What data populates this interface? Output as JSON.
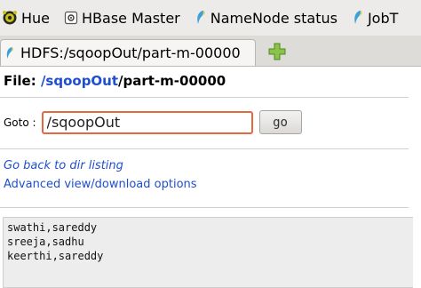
{
  "bookmarks": [
    {
      "label": "Hue",
      "icon": "hue-logo-icon"
    },
    {
      "label": "HBase Master",
      "icon": "hbase-page-icon"
    },
    {
      "label": "NameNode status",
      "icon": "hadoop-elephant-icon"
    },
    {
      "label": "JobT",
      "icon": "hadoop-elephant-icon"
    }
  ],
  "tab": {
    "title": "HDFS:/sqoopOut/part-m-00000",
    "icon": "hadoop-elephant-icon"
  },
  "new_tab_icon": "plus-icon",
  "file": {
    "label": "File: ",
    "dir_link": "/sqoopOut",
    "name": "/part-m-00000"
  },
  "goto": {
    "label": "Goto :",
    "value": "/sqoopOut",
    "button": "go"
  },
  "links": {
    "back": "Go back to dir listing",
    "advanced": "Advanced view/download options"
  },
  "file_contents": [
    "swathi,sareddy",
    "sreeja,sadhu",
    "keerthi,sareddy"
  ],
  "colors": {
    "link": "#1f4fcf",
    "input_focus_border": "#e36a3e",
    "toolbar_bg": "#ecebe9",
    "content_box_bg": "#ededed"
  }
}
